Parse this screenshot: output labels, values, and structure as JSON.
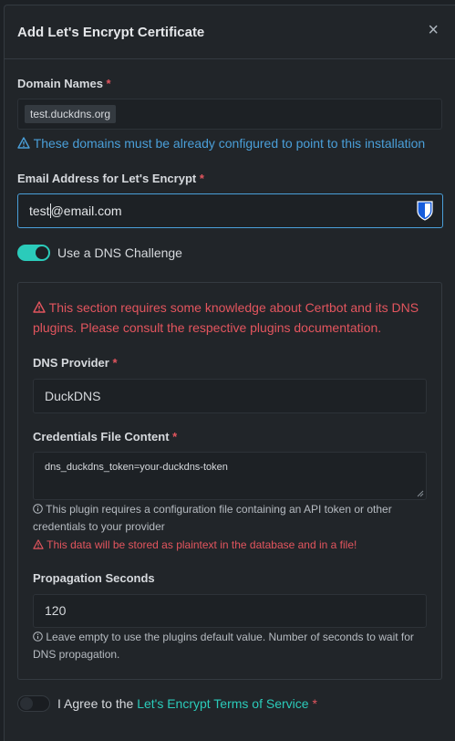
{
  "modal": {
    "title": "Add Let's Encrypt Certificate",
    "close_glyph": "×"
  },
  "domain": {
    "label": "Domain Names",
    "required_mark": "*",
    "chips": [
      "test.duckdns.org"
    ],
    "info": "These domains must be already configured to point to this installation"
  },
  "email": {
    "label": "Email Address for Let's Encrypt",
    "required_mark": "*",
    "value_before_caret": "test",
    "value_after_caret": "@email.com",
    "icon": "bitwarden-shield-icon"
  },
  "dns_toggle": {
    "label": "Use a DNS Challenge",
    "checked": true
  },
  "dns": {
    "warning": "This section requires some knowledge about Certbot and its DNS plugins. Please consult the respective plugins documentation.",
    "provider_label": "DNS Provider",
    "provider_required": "*",
    "provider_value": "DuckDNS",
    "credentials_label": "Credentials File Content",
    "credentials_required": "*",
    "credentials_value": "dns_duckdns_token=your-duckdns-token",
    "credentials_note": "This plugin requires a configuration file containing an API token or other credentials to your provider",
    "credentials_warning": "This data will be stored as plaintext in the database and in a file!",
    "propagation_label": "Propagation Seconds",
    "propagation_value": "120",
    "propagation_note": "Leave empty to use the plugins default value. Number of seconds to wait for DNS propagation."
  },
  "agree": {
    "prefix": "I Agree to the",
    "link": "Let's Encrypt Terms of Service",
    "required_mark": "*",
    "checked": false
  },
  "colors": {
    "accent_teal": "#2bcbba",
    "info_blue": "#4a9fd9",
    "danger_red": "#e3555e",
    "background": "#212529"
  }
}
